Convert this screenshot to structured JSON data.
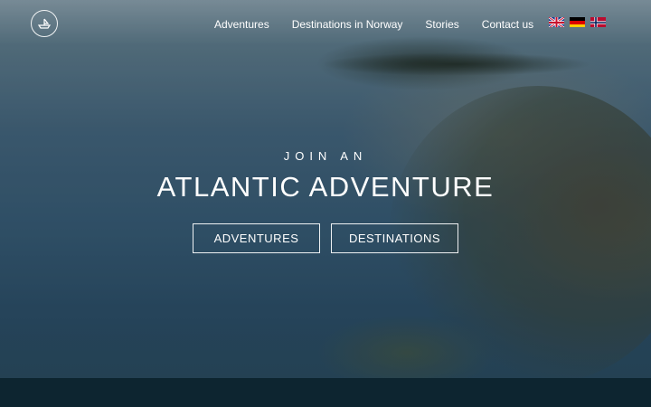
{
  "nav": {
    "items": [
      "Adventures",
      "Destinations in Norway",
      "Stories",
      "Contact us"
    ]
  },
  "languages": [
    "English",
    "German",
    "Norwegian"
  ],
  "hero": {
    "kicker": "JOIN AN",
    "headline": "ATLANTIC ADVENTURE",
    "buttons": [
      "ADVENTURES",
      "DESTINATIONS"
    ]
  },
  "colors": {
    "footer": "#0d2530",
    "text": "#ffffff"
  }
}
